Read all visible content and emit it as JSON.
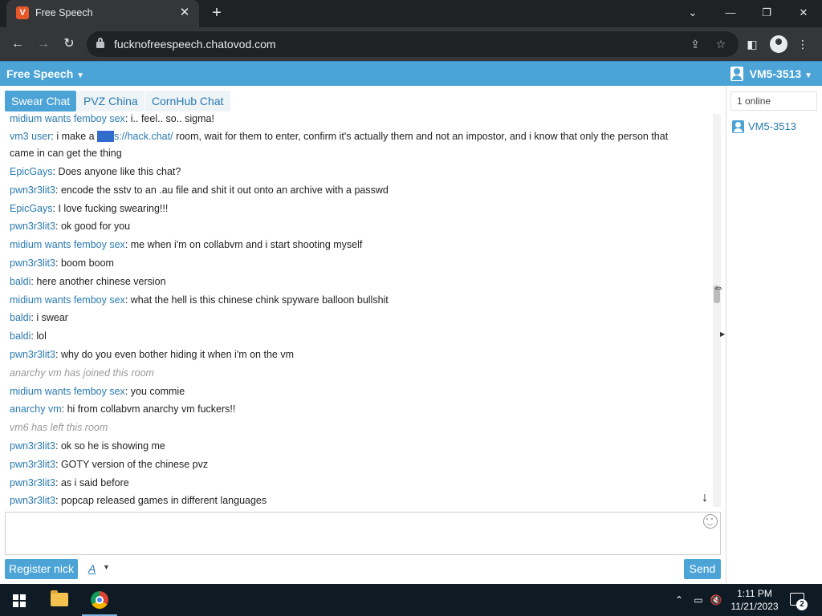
{
  "browser": {
    "tab_title": "Free Speech",
    "favicon_letter": "V",
    "url": "fucknofreespeech.chatovod.com"
  },
  "header": {
    "room_title": "Free Speech",
    "username": "VM5-3513"
  },
  "tabs": [
    "Swear Chat",
    "PVZ China",
    "CornHub Chat"
  ],
  "messages": [
    {
      "nick": "midium wants femboy sex",
      "text": "i.. feel.. so.. sigma!"
    },
    {
      "nick": "vm3 user",
      "text_before": "i make a ",
      "highlight": "http",
      "link_rest": "s://hack.chat/",
      "text_after": " room, wait for them to enter, confirm it's actually them and not an impostor, and i know that only the person that came in can get the thing"
    },
    {
      "nick": "EpicGays",
      "text": "Does anyone like this chat?"
    },
    {
      "nick": "pwn3r3lit3",
      "text": "encode the sstv to an .au file and shit it out onto an archive with a passwd"
    },
    {
      "nick": "EpicGays",
      "text": "I love fucking swearing!!!"
    },
    {
      "nick": "pwn3r3lit3",
      "text": "ok good for you"
    },
    {
      "nick": "midium wants femboy sex",
      "text": "me when i'm on collabvm and i start shooting myself"
    },
    {
      "nick": "pwn3r3lit3",
      "text": "boom boom"
    },
    {
      "nick": "baldi",
      "text": "here another chinese version"
    },
    {
      "nick": "midium wants femboy sex",
      "text": "what the hell is this chinese chink spyware balloon bullshit"
    },
    {
      "nick": "baldi",
      "text": "i swear"
    },
    {
      "nick": "baldi",
      "text": "lol"
    },
    {
      "nick": "pwn3r3lit3",
      "text": "why do you even bother hiding it when i'm on the vm"
    },
    {
      "system": "anarchy vm has joined this room"
    },
    {
      "nick": "midium wants femboy sex",
      "text": "you commie"
    },
    {
      "nick": "anarchy vm",
      "text": "hi from collabvm anarchy vm fuckers!!"
    },
    {
      "system": "vm6 has left this room"
    },
    {
      "nick": "pwn3r3lit3",
      "text": "ok so he is showing me"
    },
    {
      "nick": "pwn3r3lit3",
      "text": "GOTY version of the chinese pvz"
    },
    {
      "nick": "pwn3r3lit3",
      "text": "as i said before"
    },
    {
      "nick": "pwn3r3lit3",
      "text": "popcap released games in different languages"
    }
  ],
  "composer": {
    "register_label": "Register nick",
    "font_label": "A",
    "send_label": "Send"
  },
  "sidebar": {
    "online_count": "1 online",
    "users": [
      "VM5-3513"
    ]
  },
  "taskbar": {
    "time": "1:11 PM",
    "date": "11/21/2023",
    "notification_count": "2"
  },
  "colors": {
    "accent": "#4ba3d6",
    "nick": "#2a7ab0",
    "taskbar": "#0e1a24"
  }
}
